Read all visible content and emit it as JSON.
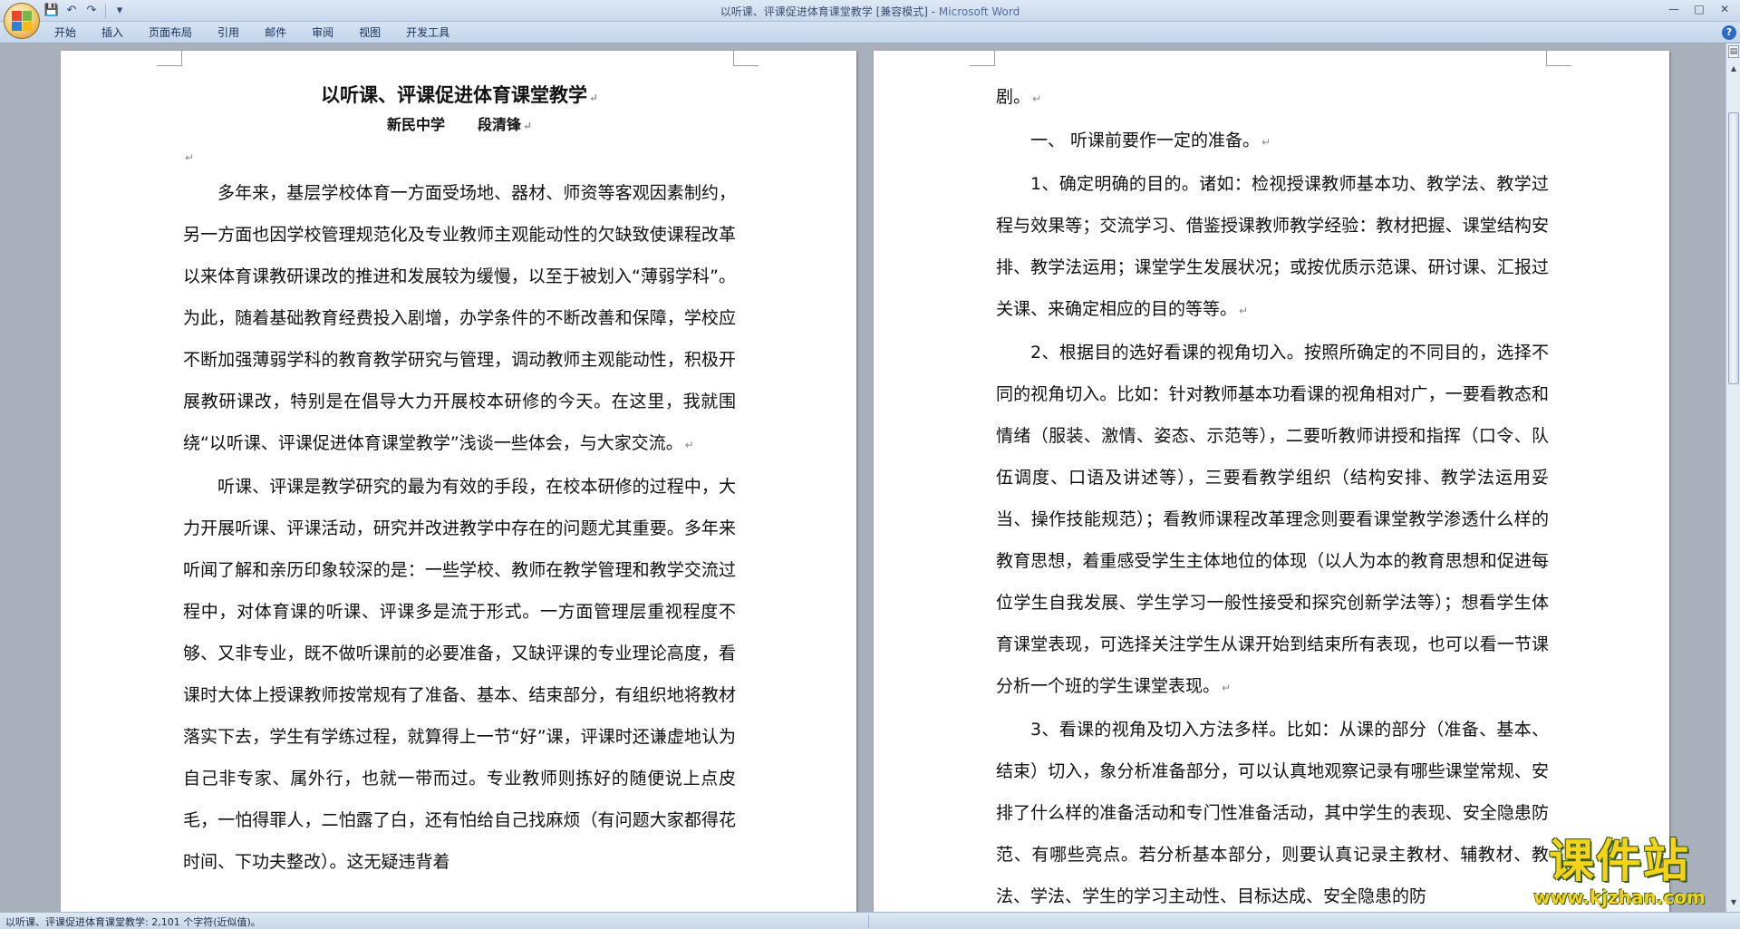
{
  "window": {
    "title_doc": "以听课、评课促进体育课堂教学 [兼容模式] - ",
    "title_app": "Microsoft Word",
    "controls": {
      "minimize": "—",
      "maximize": "□",
      "close": "✕"
    }
  },
  "qat": {
    "save": "💾",
    "undo": "↶",
    "redo": "↷",
    "customize": "▾"
  },
  "ribbon": {
    "tabs": [
      "开始",
      "插入",
      "页面布局",
      "引用",
      "邮件",
      "审阅",
      "视图",
      "开发工具"
    ],
    "help": "?"
  },
  "document": {
    "title": "以听课、评课促进体育课堂教学",
    "school": "新民中学",
    "author": "段清锋",
    "left_paragraphs": [
      "多年来，基层学校体育一方面受场地、器材、师资等客观因素制约，另一方面也因学校管理规范化及专业教师主观能动性的欠缺致使课程改革以来体育课教研课改的推进和发展较为缓慢，以至于被划入“薄弱学科”。为此，随着基础教育经费投入剧增，办学条件的不断改善和保障，学校应不断加强薄弱学科的教育教学研究与管理，调动教师主观能动性，积极开展教研课改，特别是在倡导大力开展校本研修的今天。在这里，我就围绕“以听课、评课促进体育课堂教学”浅谈一些体会，与大家交流。",
      "听课、评课是教学研究的最为有效的手段，在校本研修的过程中，大力开展听课、评课活动，研究并改进教学中存在的问题尤其重要。多年来听闻了解和亲历印象较深的是：一些学校、教师在教学管理和教学交流过程中，对体育课的听课、评课多是流于形式。一方面管理层重视程度不够、又非专业，既不做听课前的必要准备，又缺评课的专业理论高度，看课时大体上授课教师按常规有了准备、基本、结束部分，有组织地将教材落实下去，学生有学练过程，就算得上一节“好”课，评课时还谦虚地认为自己非专家、属外行，也就一带而过。专业教师则拣好的随便说上点皮毛，一怕得罪人，二怕露了白，还有怕给自己找麻烦（有问题大家都得花时间、下功夫整改）。这无疑违背着"
    ],
    "right_paragraphs": [
      {
        "text": "剧。",
        "indent": false
      },
      {
        "text": "一、  听课前要作一定的准备。",
        "indent": true
      },
      {
        "text": "1、确定明确的目的。诸如：检视授课教师基本功、教学法、教学过程与效果等；交流学习、借鉴授课教师教学经验：教材把握、课堂结构安排、教学法运用；课堂学生发展状况；或按优质示范课、研讨课、汇报过关课、来确定相应的目的等等。",
        "indent": true
      },
      {
        "text": "2、根据目的选好看课的视角切入。按照所确定的不同目的，选择不同的视角切入。比如：针对教师基本功看课的视角相对广，一要看教态和情绪（服装、激情、姿态、示范等），二要听教师讲授和指挥（口令、队伍调度、口语及讲述等），三要看教学组织（结构安排、教学法运用妥当、操作技能规范）；看教师课程改革理念则要看课堂教学渗透什么样的教育思想，着重感受学生主体地位的体现（以人为本的教育思想和促进每位学生自我发展、学生学习一般性接受和探究创新学法等）；想看学生体育课堂表现，可选择关注学生从课开始到结束所有表现，也可以看一节课分析一个班的学生课堂表现。",
        "indent": true
      },
      {
        "text": "3、看课的视角及切入方法多样。比如：从课的部分（准备、基本、结束）切入，象分析准备部分，可以认真地观察记录有哪些课堂常规、安排了什么样的准备活动和专门性准备活动，其中学生的表现、安全隐患防范、有哪些亮点。若分析基本部分，则要认真记录主教材、辅教材、教法、学法、学生的学习主动性、目标达成、安全隐患的防",
        "indent": true
      }
    ],
    "paragraph_mark": "↵"
  },
  "statusbar": {
    "text": "以听课、评课促进体育课堂教学: 2,101 个字符(近似值)。"
  },
  "scrollbar": {
    "ruler_toggle": "▤",
    "up": "▲",
    "down": "▼"
  },
  "watermark": {
    "main": "课件站",
    "url": "www.kjzhan.com"
  },
  "colors": {
    "office_logo": [
      "#e8472b",
      "#7ab648",
      "#2d7fd8",
      "#f7b918"
    ],
    "watermark_fill": "#f5d31a",
    "watermark_outline": "#3a5b12"
  }
}
